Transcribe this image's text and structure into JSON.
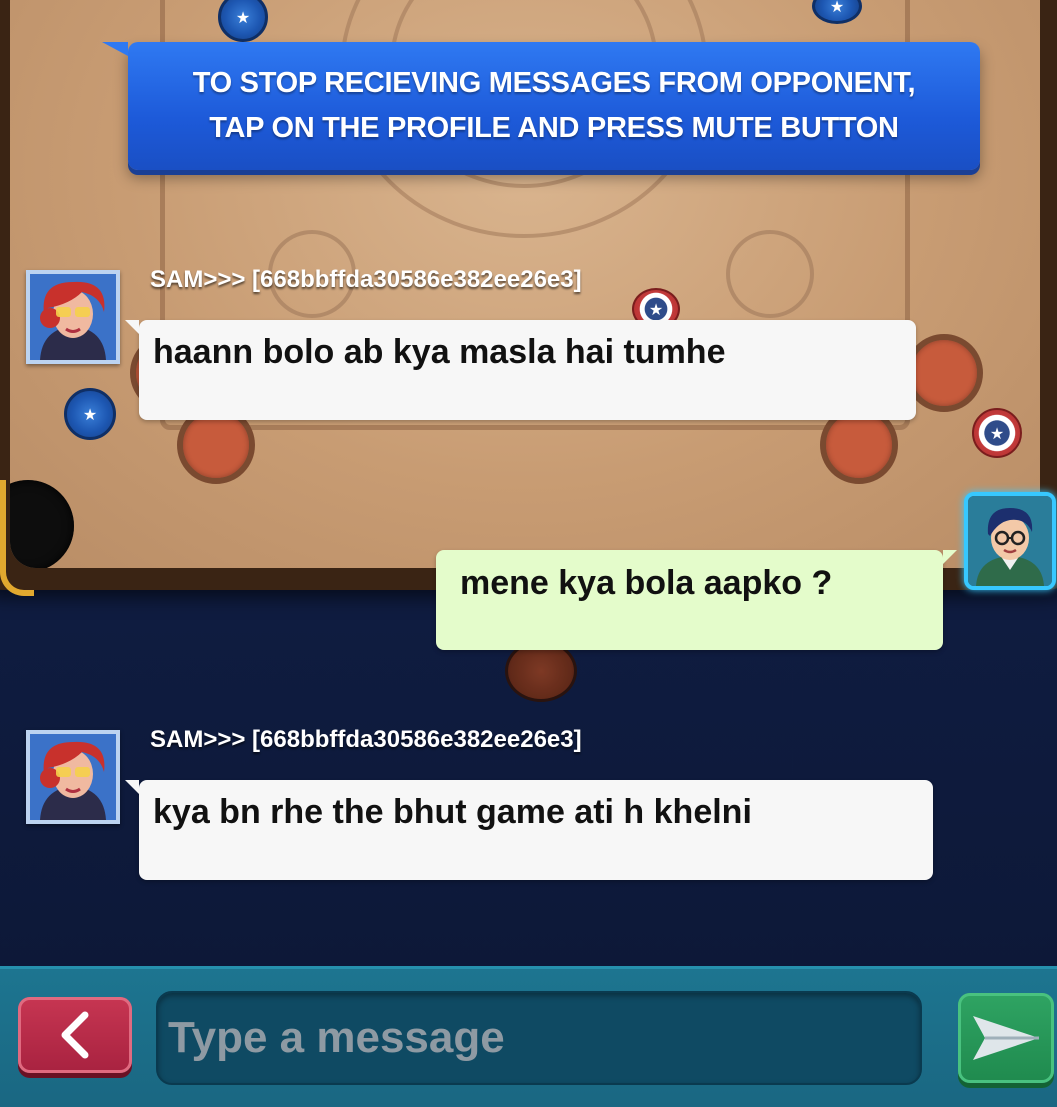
{
  "tip": {
    "line1": "TO STOP RECIEVING MESSAGES FROM OPPONENT,",
    "line2": "TAP ON THE PROFILE AND PRESS MUTE BUTTON"
  },
  "messages": [
    {
      "from": "opponent",
      "sender": "SAM>>> [668bbffda30586e382ee26e3]",
      "text": "haann bolo ab kya masla hai tumhe"
    },
    {
      "from": "me",
      "sender": "",
      "text": "mene kya bola aapko ?"
    },
    {
      "from": "opponent",
      "sender": "SAM>>> [668bbffda30586e382ee26e3]",
      "text": "kya bn rhe the bhut game ati h khelni"
    }
  ],
  "composer": {
    "placeholder": "Type a message",
    "back_icon": "chevron-left-icon",
    "send_icon": "send-arrow-icon"
  },
  "colors": {
    "tip_bg": "#1d5ad9",
    "opponent_bubble": "#f7f7f7",
    "my_bubble": "#e4fccb",
    "bottom_bar": "#1a6782",
    "back_button": "#b52845",
    "send_button": "#2a9a5a"
  }
}
